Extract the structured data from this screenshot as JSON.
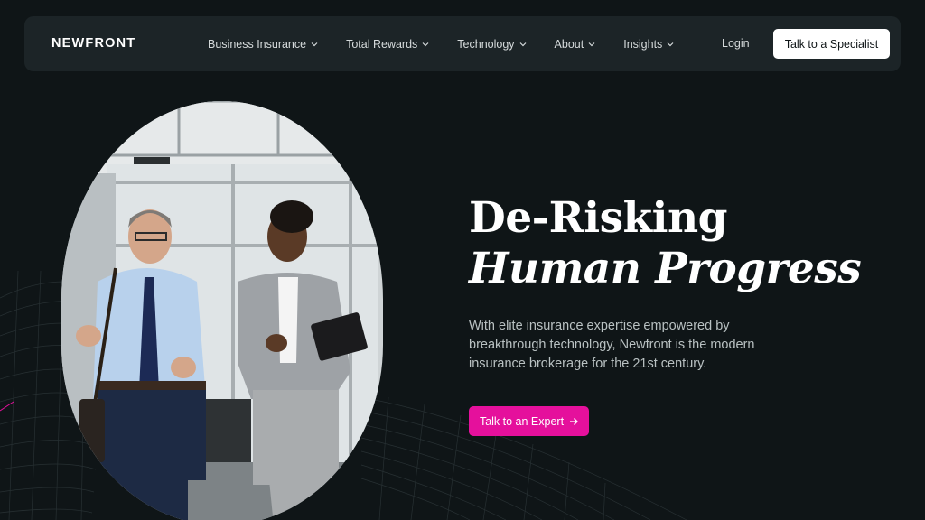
{
  "brand": {
    "logo_text": "NEWFRONT"
  },
  "nav": {
    "items": [
      {
        "label": "Business Insurance"
      },
      {
        "label": "Total Rewards"
      },
      {
        "label": "Technology"
      },
      {
        "label": "About"
      },
      {
        "label": "Insights"
      }
    ],
    "login_label": "Login",
    "cta_label": "Talk to a Specialist"
  },
  "hero": {
    "headline_line1": "De-Risking",
    "headline_line2": "Human Progress",
    "subcopy": "With elite insurance expertise empowered by breakthrough technology, Newfront is the modern insurance brokerage for the 21st century.",
    "cta_label": "Talk to an Expert",
    "cta_icon": "arrow-right-icon"
  },
  "colors": {
    "background": "#0f1517",
    "nav_background": "#1c2427",
    "accent": "#e5109c",
    "text_primary": "#ffffff",
    "text_secondary": "#b9c1c2"
  }
}
